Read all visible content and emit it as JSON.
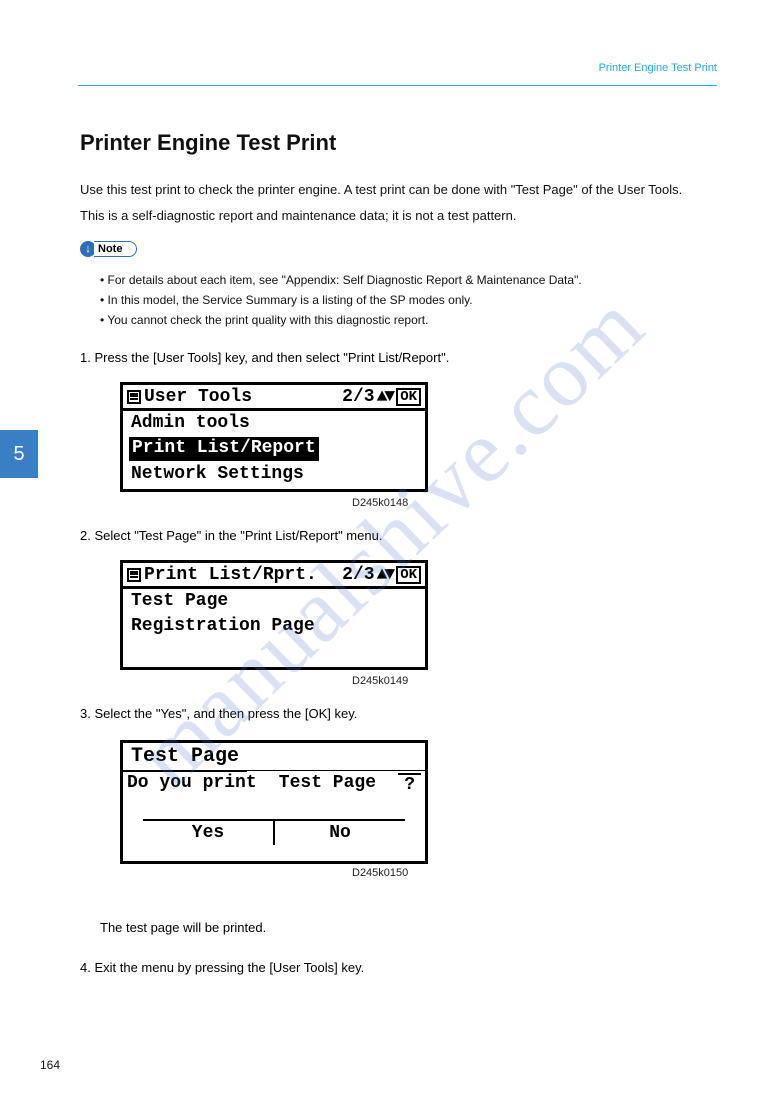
{
  "header": {
    "label": "Printer Engine Test Print",
    "section_title": "Printer Engine Test Print"
  },
  "intro": {
    "line1": "Use this test print to check the printer engine. A test print can be done with \"Test Page\" of the User Tools.",
    "line2": "This is a self-diagnostic report and maintenance data; it is not a test pattern."
  },
  "note": {
    "label": "Note",
    "bullets": [
      "For details about each item, see \"Appendix: Self Diagnostic Report & Maintenance Data\".",
      "In this model, the Service Summary is a listing of the SP modes only.",
      "You cannot check the print quality with this diagnostic report."
    ]
  },
  "steps": {
    "s1": "1.  Press the [User Tools] key, and then select \"Print List/Report\".",
    "s2": "2.  Select \"Test Page\" in the \"Print List/Report\" menu.",
    "s3": "3.  Select the \"Yes\", and then press the [OK] key.",
    "s4": "The test page will be printed.",
    "s5": "4.  Exit the menu by pressing the [User Tools] key."
  },
  "lcd1": {
    "title": "User Tools",
    "page": "2/3",
    "ok": "OK",
    "items": [
      "Admin tools",
      "Print List/Report",
      "Network Settings"
    ],
    "selected_index": 1,
    "img_id": "D245k0148"
  },
  "lcd2": {
    "title": "Print List/Rprt.",
    "page": "2/3",
    "ok": "OK",
    "items": [
      "Test Page",
      "Registration Page"
    ],
    "img_id": "D245k0149"
  },
  "lcd3": {
    "title": "Test Page",
    "prompt_left": "Do you print",
    "prompt_right": "Test Page",
    "qmark": "?",
    "yes": "Yes",
    "no": "No",
    "img_id": "D245k0150"
  },
  "page_tab": "5",
  "footer": "164",
  "watermark": "manualshive.com"
}
